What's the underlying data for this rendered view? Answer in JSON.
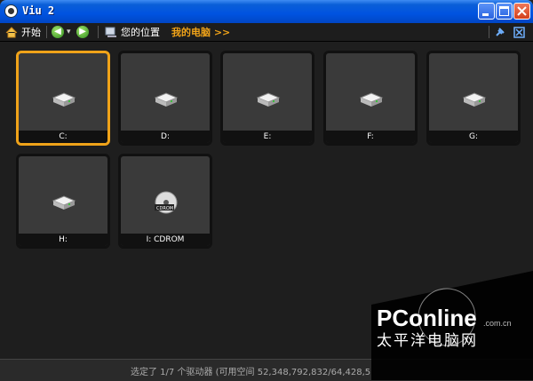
{
  "window": {
    "title": "Viu 2"
  },
  "toolbar": {
    "home_label": "开始",
    "location_label": "您的位置",
    "breadcrumb": "我的电脑 >>"
  },
  "drives": [
    {
      "label": "C: ",
      "icon": "hard-drive-icon",
      "selected": true
    },
    {
      "label": "D: ",
      "icon": "hard-drive-icon"
    },
    {
      "label": "E: ",
      "icon": "hard-drive-icon"
    },
    {
      "label": "F: ",
      "icon": "hard-drive-icon"
    },
    {
      "label": "G: ",
      "icon": "hard-drive-icon"
    },
    {
      "label": "H: ",
      "icon": "hard-drive-icon"
    },
    {
      "label": "I: CDROM",
      "icon": "cdrom-icon",
      "disc_text": "CDROM"
    }
  ],
  "status": {
    "text": "选定了 1/7 个驱动器 (可用空间 52,348,792,832/64,428,5"
  },
  "watermark": {
    "brand": "PConline",
    "domain": ".com.cn",
    "cn": "太平洋电脑网"
  },
  "colors": {
    "selection": "#f0a319",
    "title_bar": "#0053e0",
    "background": "#1e1e1e"
  }
}
